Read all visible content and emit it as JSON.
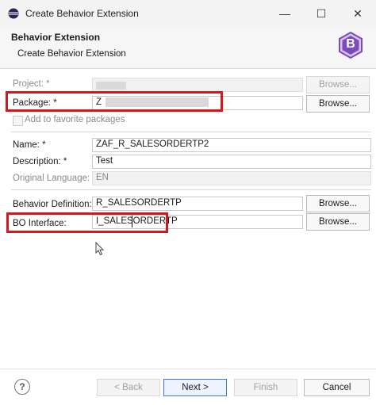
{
  "window": {
    "title": "Create Behavior Extension",
    "minimize_glyph": "—",
    "maximize_glyph": "☐",
    "close_glyph": "✕"
  },
  "header": {
    "title": "Behavior Extension",
    "description": "Create Behavior Extension",
    "badge_letter": "B",
    "badge_color": "#7b4bb7"
  },
  "form": {
    "project": {
      "label": "Project: *",
      "browse": "Browse..."
    },
    "package": {
      "label": "Package: *",
      "value": "Z",
      "browse": "Browse..."
    },
    "favorite": {
      "label": "Add to favorite packages",
      "checked": false
    },
    "name": {
      "label": "Name: *",
      "value": "ZAF_R_SALESORDERTP2"
    },
    "description": {
      "label": "Description: *",
      "value": "Test"
    },
    "original_language": {
      "label": "Original Language:",
      "value": "EN"
    },
    "behavior_definition": {
      "label": "Behavior Definition: *",
      "value": "R_SALESORDERTP",
      "browse": "Browse..."
    },
    "bo_interface": {
      "label": "BO Interface:",
      "value": "I_SALESORDERTP",
      "browse": "Browse..."
    }
  },
  "footer": {
    "help_glyph": "?",
    "back": "< Back",
    "next": "Next >",
    "finish": "Finish",
    "cancel": "Cancel"
  },
  "highlight_color": "#d0181f"
}
